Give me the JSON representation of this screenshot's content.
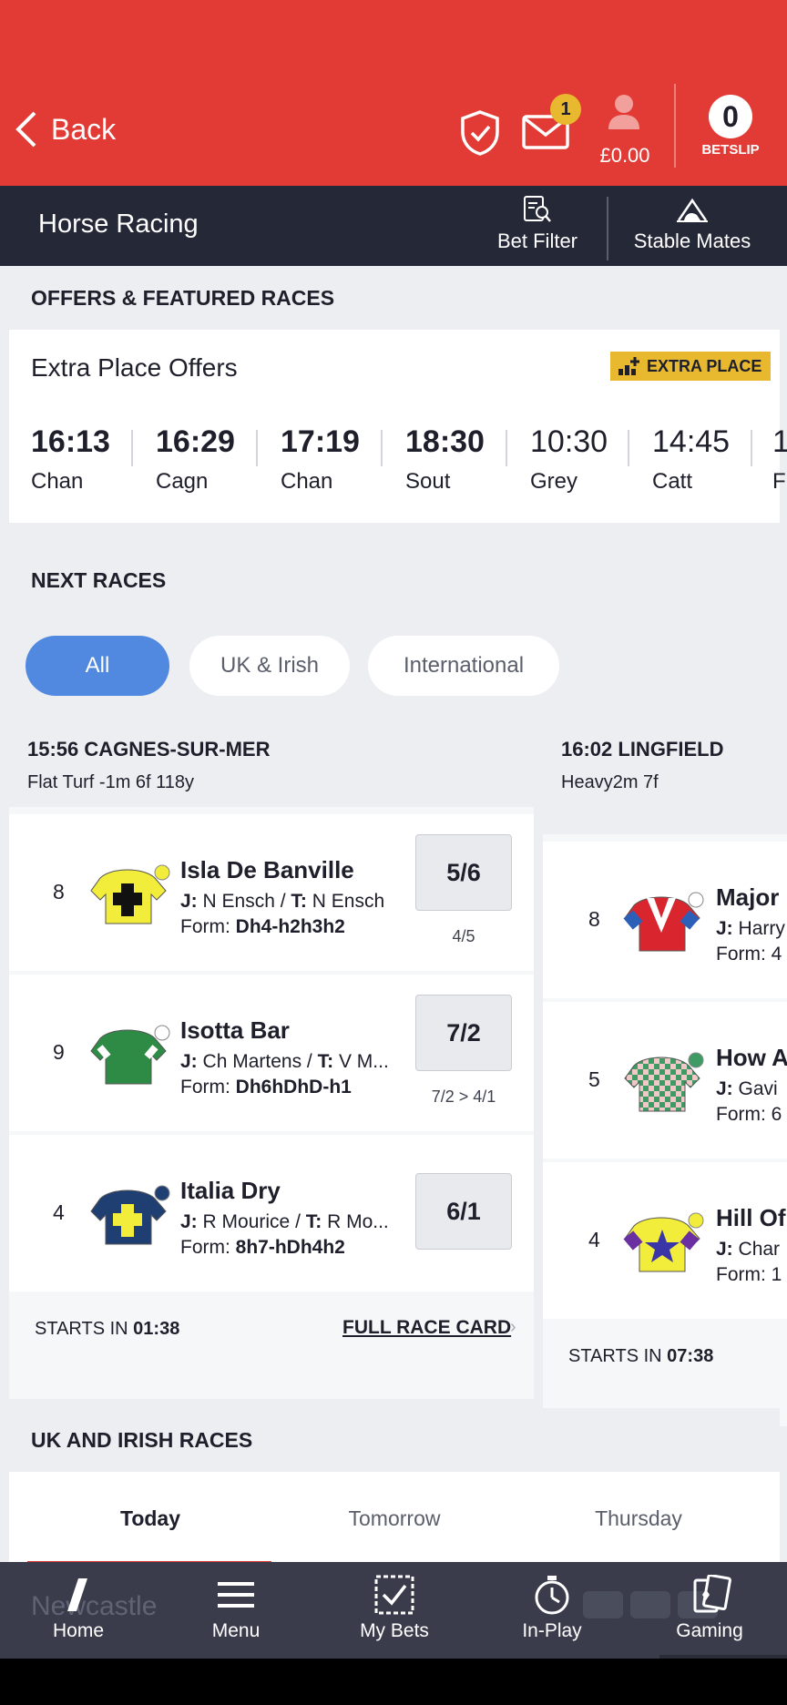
{
  "header": {
    "back_label": "Back",
    "mail_badge": "1",
    "balance": "£0.00",
    "betslip_count": "0",
    "betslip_label": "BETSLIP",
    "brand_color": "#e23a35"
  },
  "subheader": {
    "title": "Horse Racing",
    "bet_filter_label": "Bet Filter",
    "stable_mates_label": "Stable Mates"
  },
  "offers": {
    "section_title": "OFFERS & FEATURED RACES",
    "card_title": "Extra Place Offers",
    "badge_label": "EXTRA PLACE",
    "races": [
      {
        "time": "16:13",
        "course": "Chan"
      },
      {
        "time": "16:29",
        "course": "Cagn"
      },
      {
        "time": "17:19",
        "course": "Chan"
      },
      {
        "time": "18:30",
        "course": "Sout"
      },
      {
        "time": "10:30",
        "course": "Grey"
      },
      {
        "time": "14:45",
        "course": "Catt"
      },
      {
        "time": "1",
        "course": "F"
      }
    ]
  },
  "next_races": {
    "section_title": "NEXT RACES",
    "filters": [
      "All",
      "UK & Irish",
      "International"
    ],
    "races": [
      {
        "name": "15:56 CAGNES-SUR-MER",
        "type": "Flat Turf -1m 6f 118y",
        "runners": [
          {
            "num": "8",
            "name": "Isla De Banville",
            "jockey": "N Ensch",
            "trainer": "N Ensch",
            "form": "Dh4-h2h3h2",
            "odds": "5/6",
            "prev": "4/5"
          },
          {
            "num": "9",
            "name": "Isotta Bar",
            "jockey": "Ch Martens",
            "trainer": "V M...",
            "form": "Dh6hDhD-h1",
            "odds": "7/2",
            "prev": "7/2 > 4/1"
          },
          {
            "num": "4",
            "name": "Italia Dry",
            "jockey": "R Mourice",
            "trainer": "R Mo...",
            "form": "8h7-hDh4h2",
            "odds": "6/1",
            "prev": ""
          }
        ],
        "starts_prefix": "STARTS IN",
        "starts_time": "01:38",
        "full_card_label": "FULL RACE CARD"
      },
      {
        "name": "16:02 LINGFIELD",
        "type": "Heavy2m 7f",
        "runners": [
          {
            "num": "8",
            "name": "Major",
            "jockey": "Harry",
            "form": "4"
          },
          {
            "num": "5",
            "name": "How A",
            "jockey": "Gavi",
            "form": "6"
          },
          {
            "num": "4",
            "name": "Hill Of",
            "jockey": "Char",
            "form": "1"
          }
        ],
        "starts_prefix": "STARTS IN",
        "starts_time": "07:38"
      }
    ],
    "labels": {
      "jockey": "J:",
      "trainer": "T:",
      "form": "Form:"
    }
  },
  "uk_irish": {
    "section_title": "UK AND IRISH RACES",
    "tabs": [
      "Today",
      "Tomorrow",
      "Thursday"
    ],
    "first_meeting": "Newcastle"
  },
  "bottom_nav": {
    "items": [
      "Home",
      "Menu",
      "My Bets",
      "In-Play",
      "Gaming"
    ]
  }
}
